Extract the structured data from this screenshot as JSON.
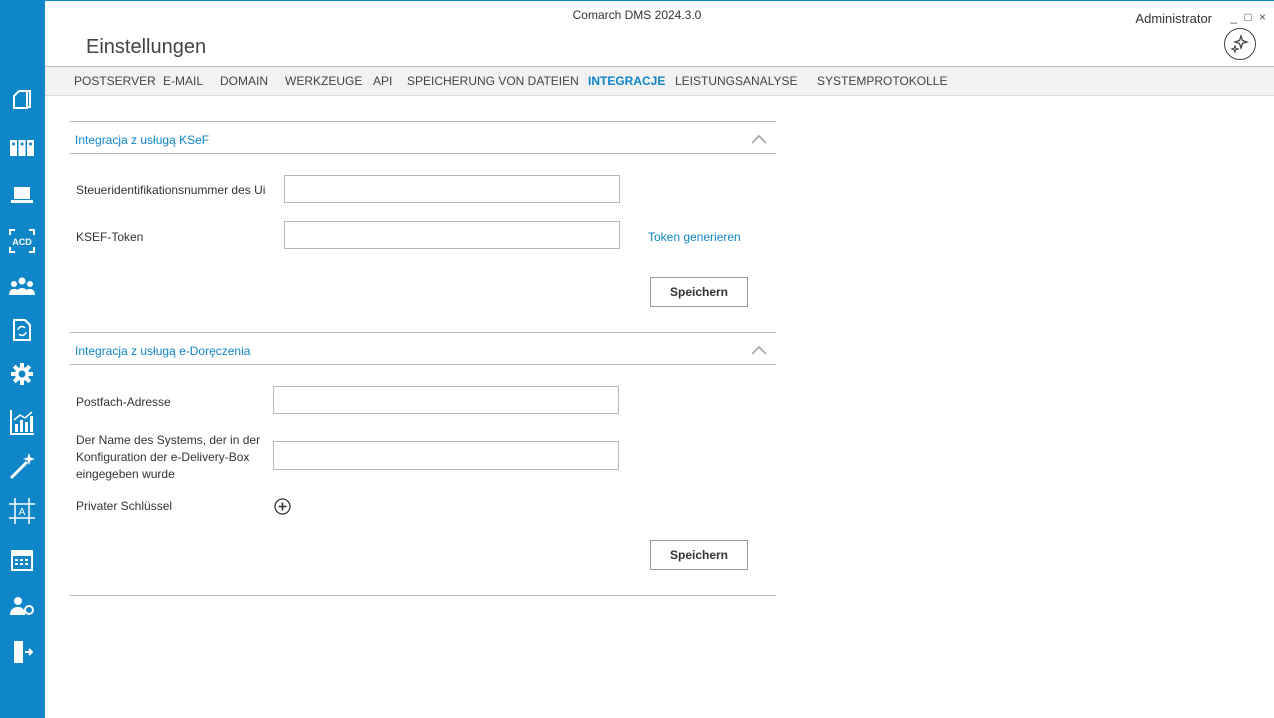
{
  "window": {
    "app_title": "Comarch DMS 2024.3.0",
    "user": "Administrator",
    "controls": {
      "minimize": "_",
      "maximize": "□",
      "close": "×"
    }
  },
  "page": {
    "title": "Einstellungen"
  },
  "tabs": [
    {
      "label": "POSTSERVER",
      "active": false
    },
    {
      "label": "E-MAIL",
      "active": false
    },
    {
      "label": "DOMAIN",
      "active": false
    },
    {
      "label": "WERKZEUGE",
      "active": false
    },
    {
      "label": "API",
      "active": false
    },
    {
      "label": "SPEICHERUNG VON DATEIEN",
      "active": false
    },
    {
      "label": "INTEGRACJE",
      "active": true
    },
    {
      "label": "LEISTUNGSANALYSE",
      "active": false
    },
    {
      "label": "SYSTEMPROTOKOLLE",
      "active": false
    }
  ],
  "sidebar": {
    "icons": [
      "documents-icon",
      "binders-icon",
      "laptop-icon",
      "acd-icon",
      "users-icon",
      "document-sync-icon",
      "settings-gear-icon",
      "analytics-chart-icon",
      "magic-wand-icon",
      "text-frame-icon",
      "calendar-icon",
      "user-settings-icon",
      "logout-door-icon"
    ]
  },
  "ksef": {
    "title": "Integracja z usługą KSeF",
    "tax_id_label": "Steueridentifikationsnummer des Ui",
    "tax_id_value": "",
    "token_label": "KSEF-Token",
    "token_value": "",
    "generate_link": "Token generieren",
    "save_label": "Speichern"
  },
  "edelivery": {
    "title": "Integracja z usługą e-Doręczenia",
    "mailbox_label": "Postfach-Adresse",
    "mailbox_value": "",
    "system_name_label": "Der Name des Systems, der in der Konfiguration der e-Delivery-Box eingegeben wurde",
    "system_name_value": "",
    "private_key_label": "Privater Schlüssel",
    "save_label": "Speichern"
  },
  "colors": {
    "accent": "#0f86c8",
    "sidebar": "#0f86c8"
  }
}
